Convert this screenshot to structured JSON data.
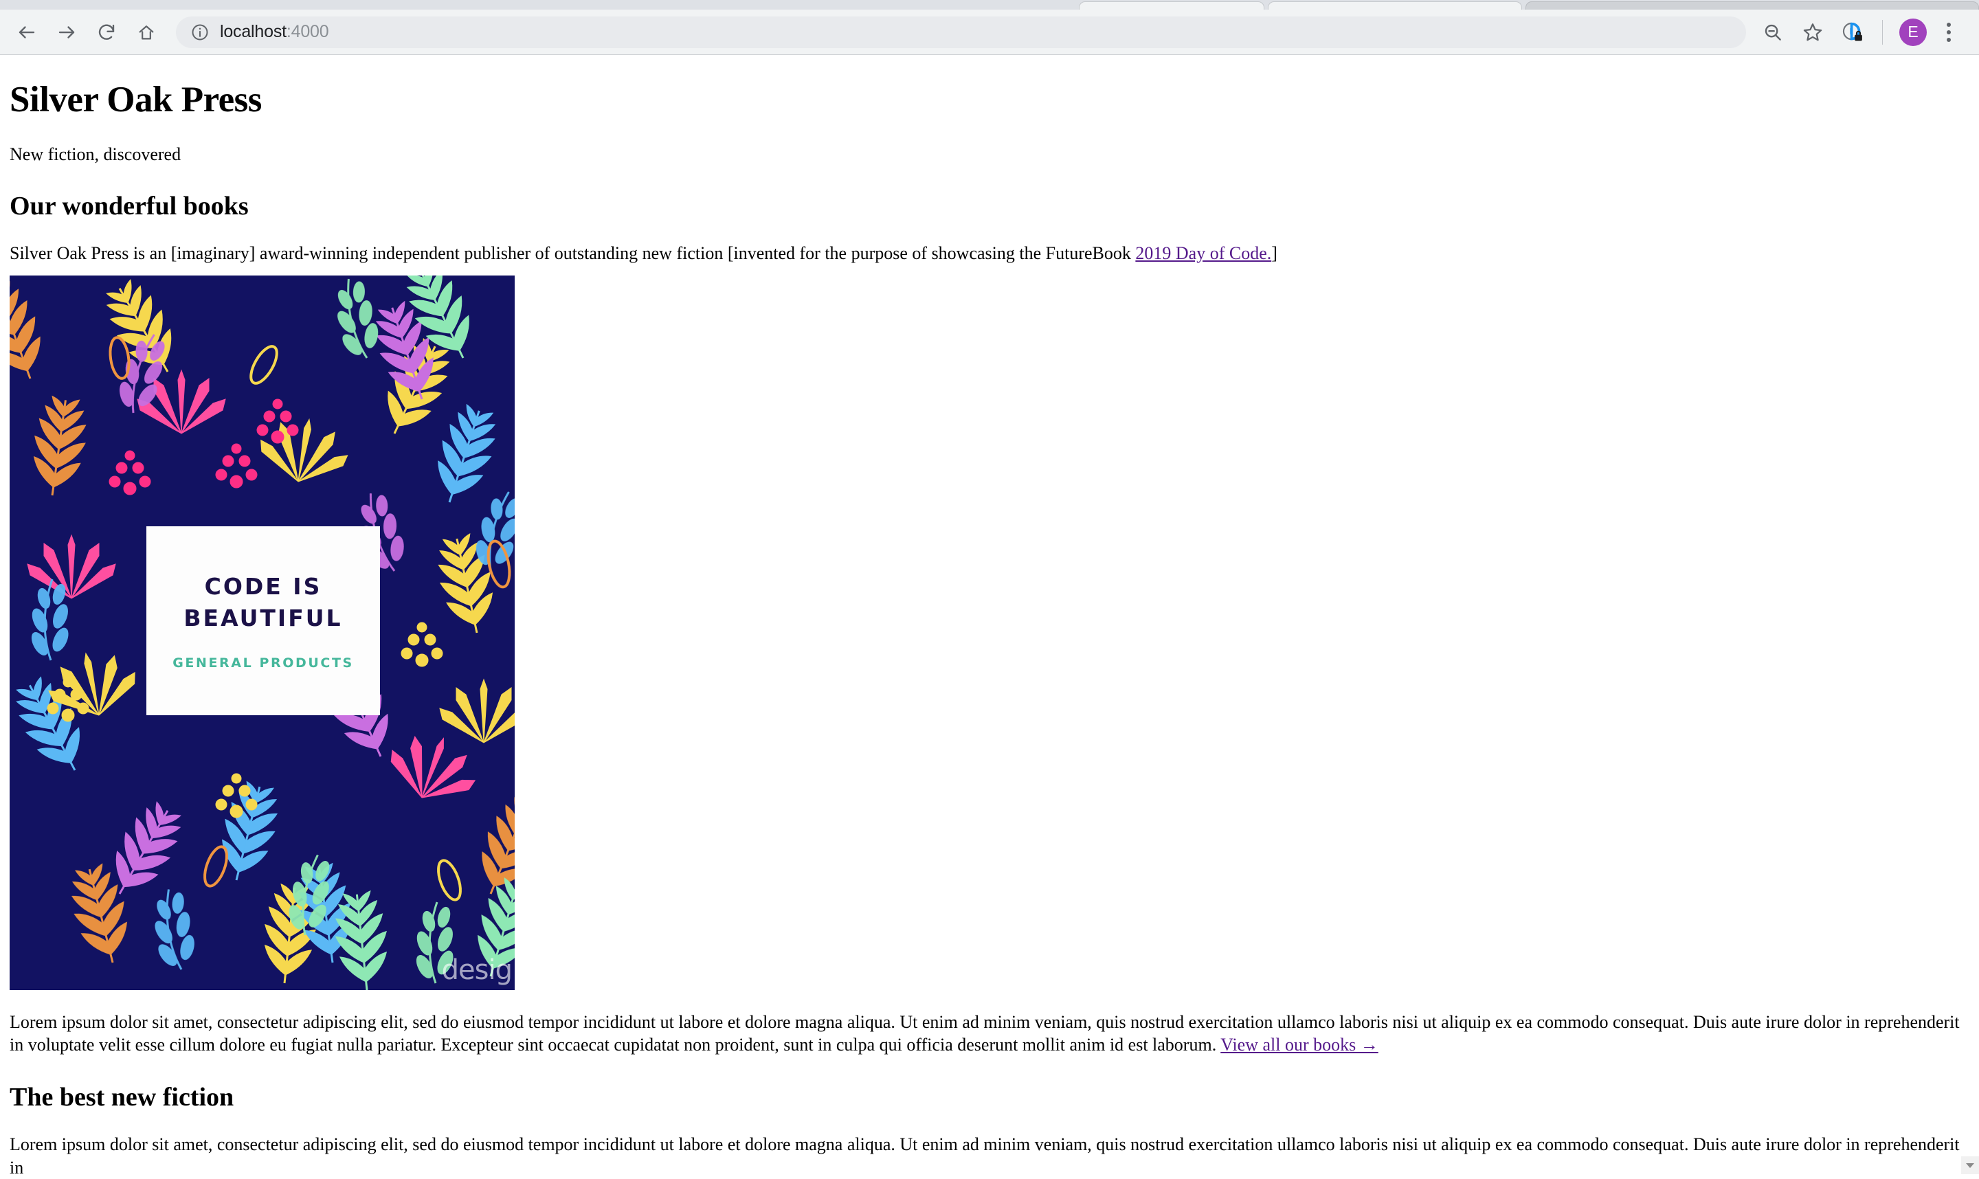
{
  "browser": {
    "back_label": "Back",
    "forward_label": "Forward",
    "reload_label": "Reload",
    "home_label": "Home",
    "url_host": "localhost",
    "url_port": ":4000",
    "url_full": "localhost:4000",
    "info_icon": "site-info-icon",
    "zoom_out_icon": "zoom-out-icon",
    "bookmark_icon": "bookmark-star-icon",
    "extension_icon": "extension-lock-icon",
    "profile_initial": "E",
    "menu_icon": "three-dot-menu-icon",
    "accent_avatar_color": "#a142bd"
  },
  "page": {
    "site_title": "Silver Oak Press",
    "tagline": "New fiction, discovered",
    "sections": [
      {
        "heading": "Our wonderful books",
        "intro_before_link": "Silver Oak Press is an [imaginary] award-winning independent publisher of outstanding new fiction [invented for the purpose of showcasing the FutureBook ",
        "intro_link": "2019 Day of Code.",
        "intro_after_link": "]"
      },
      {
        "heading": "The best new fiction",
        "body": "Lorem ipsum dolor sit amet, consectetur adipiscing elit, sed do eiusmod tempor incididunt ut labore et dolore magna aliqua. Ut enim ad minim veniam, quis nostrud exercitation ullamco laboris nisi ut aliquip ex ea commodo consequat. Duis aute irure dolor in reprehenderit in"
      }
    ],
    "cover": {
      "title_line1": "CODE IS",
      "title_line2": "BEAUTIFUL",
      "subtitle": "GENERAL PRODUCTS",
      "watermark": "desig",
      "background_color": "#121262",
      "title_color": "#1b1147",
      "subtitle_color": "#45b79b"
    },
    "lede": {
      "text": "Lorem ipsum dolor sit amet, consectetur adipiscing elit, sed do eiusmod tempor incididunt ut labore et dolore magna aliqua. Ut enim ad minim veniam, quis nostrud exercitation ullamco laboris nisi ut aliquip ex ea commodo consequat. Duis aute irure dolor in reprehenderit in voluptate velit esse cillum dolore eu fugiat nulla pariatur. Excepteur sint occaecat cupidatat non proident, sunt in culpa qui officia deserunt mollit anim id est laborum. ",
      "link": "View all our books →"
    },
    "link_color": "#551a8b"
  }
}
